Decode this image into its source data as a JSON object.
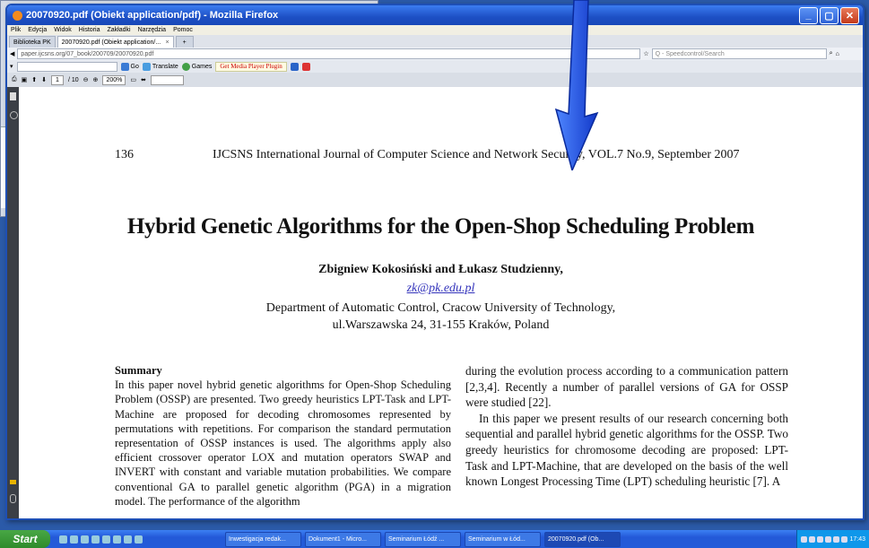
{
  "window": {
    "title": "20070920.pdf (Obiekt application/pdf) - Mozilla Firefox"
  },
  "menu": [
    "Plik",
    "Edycja",
    "Widok",
    "Historia",
    "Zakładki",
    "Narzędzia",
    "Pomoc"
  ],
  "tabs": {
    "bookmark": "Biblioteka PK",
    "active": "20070920.pdf (Obiekt application/...",
    "close": "×",
    "new": "+"
  },
  "nav": {
    "url": "paper.ijcsns.org/07_book/200709/20070920.pdf",
    "search_placeholder": "Q - Speedcontrol/Search"
  },
  "toolbar2": {
    "go": "Go",
    "translate": "Translate",
    "games": "Games",
    "media": "Get Media Player Plugin"
  },
  "pdfbar": {
    "page_current": "1",
    "page_total": "/ 10",
    "zoom": "200%"
  },
  "paper": {
    "page_number": "136",
    "journal": "IJCSNS International Journal of Computer Science and Network Security, VOL.7 No.9, September 2007",
    "title": "Hybrid Genetic Algorithms for the Open-Shop Scheduling Problem",
    "authors": "Zbigniew Kokosiński and Łukasz Studzienny,",
    "email": "zk@pk.edu.pl",
    "affil1": "Department of Automatic Control, Cracow University of Technology,",
    "affil2": "ul.Warszawska 24, 31-155 Kraków, Poland",
    "summary_head": "Summary",
    "summary_text": "In this paper novel hybrid genetic algorithms for Open-Shop Scheduling Problem (OSSP) are presented. Two greedy heuristics LPT-Task and LPT-Machine are proposed for decoding chromosomes represented by permutations with repetitions. For comparison the standard permutation representation of OSSP instances is used. The algorithms apply also efficient crossover operator LOX and mutation operators SWAP and INVERT with constant and variable mutation probabilities. We compare conventional GA to parallel genetic algorithm (PGA) in a migration model. The performance of the algorithm",
    "right_p1": "during the evolution process according to a communication pattern [2,3,4]. Recently a number of parallel versions of GA for OSSP were studied [22].",
    "right_p2": "In this paper we present results of our research concerning both sequential and parallel hybrid genetic algorithms for the OSSP. Two greedy heuristics for chromosome decoding are proposed: LPT-Task and LPT-Machine, that are developed on the basis of the well known Longest Processing Time (LPT) scheduling heuristic [7]. A"
  },
  "taskbar": {
    "start": "Start",
    "tasks": [
      "Inwestigacja redak...",
      "Dokument1 - Micro...",
      "Seminarium Łódź ...",
      "Seminarium w Łód...",
      "20070920.pdf (Ob..."
    ],
    "clock": "17:43"
  },
  "colors": {
    "arrow": "#1f55e0",
    "title_blue": "#1d4fc4",
    "taskbar": "#245bd9"
  }
}
